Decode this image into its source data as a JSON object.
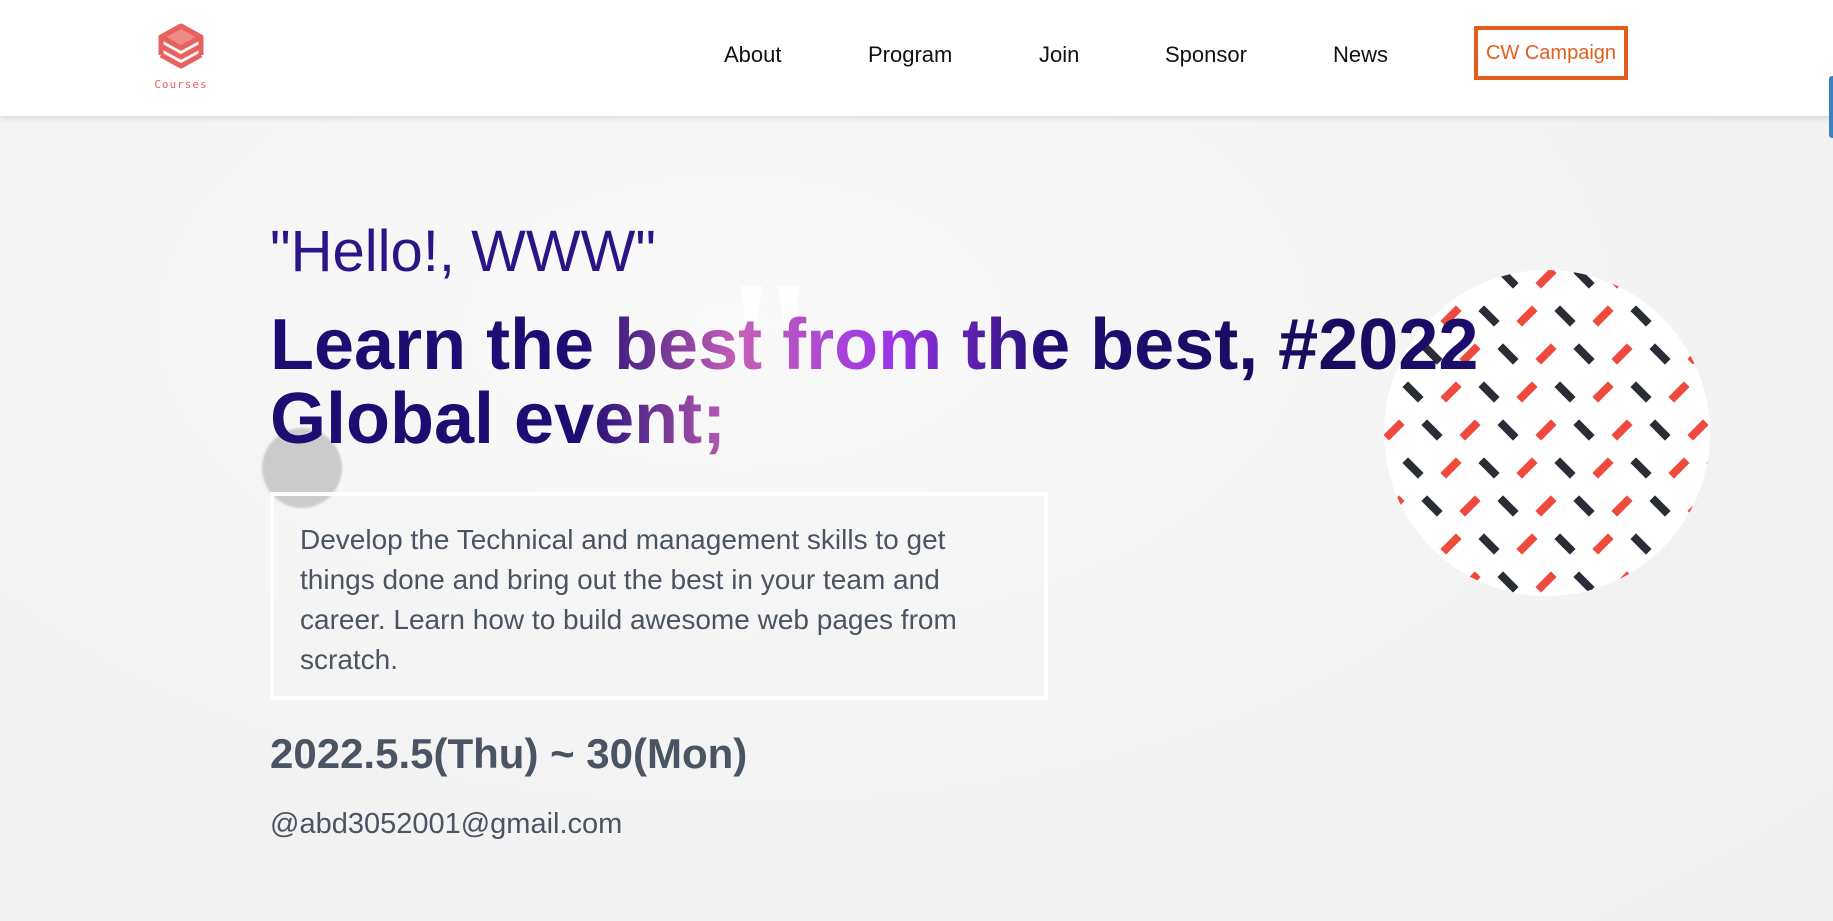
{
  "logo": {
    "text": "Courses",
    "icon": "stacked-diamond-logo-icon",
    "color": "#e8615f"
  },
  "nav": {
    "items": [
      {
        "label": "About"
      },
      {
        "label": "Program"
      },
      {
        "label": "Join"
      },
      {
        "label": "Sponsor"
      },
      {
        "label": "News"
      }
    ],
    "campaign_label": "CW Campaign",
    "campaign_color": "#e35d1f"
  },
  "hero": {
    "greeting": "\"Hello!, WWW\"",
    "headline": "Learn the best from the best, #2022 Global event;",
    "description": "Develop the Technical and management skills to get things done and bring out the best in your team and career. Learn how to build awesome web pages from scratch.",
    "date": "2022.5.5(Thu) ~ 30(Mon)",
    "email": "@abd3052001@gmail.com"
  },
  "colors": {
    "headline": "#1f0c73",
    "greeting": "#2c1487",
    "body_text": "#4a5462",
    "pattern_red": "#f04a3c",
    "pattern_dark": "#2a2d36"
  }
}
